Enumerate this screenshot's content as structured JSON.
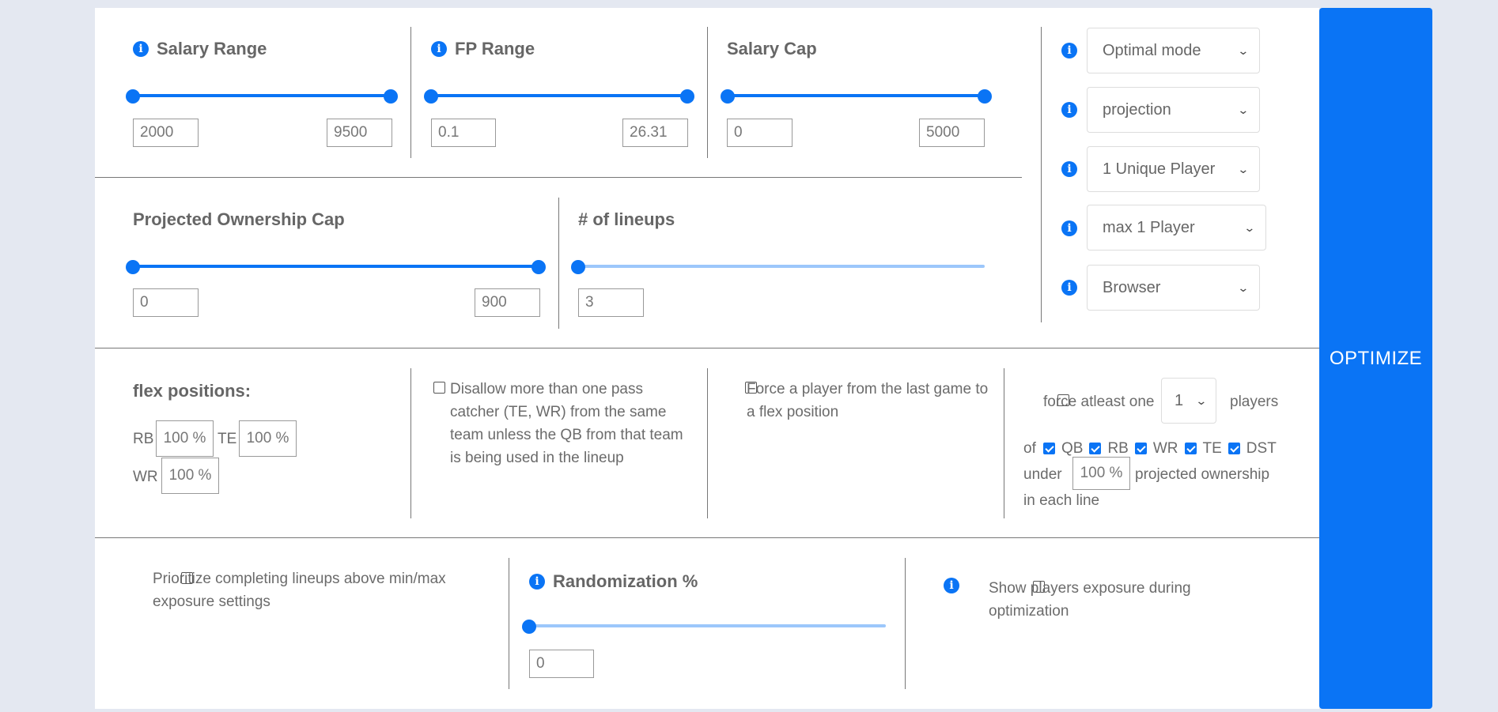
{
  "range_filters": {
    "salary_range": {
      "title": "Salary Range",
      "min": "2000",
      "max": "9500",
      "low_fraction": 0,
      "high_fraction": 1
    },
    "fp_range": {
      "title": "FP Range",
      "min": "0.1",
      "max": "26.31",
      "low_fraction": 0,
      "high_fraction": 1
    },
    "salary_cap": {
      "title": "Salary Cap",
      "min": "0",
      "max": "5000",
      "low_fraction": 0,
      "high_fraction": 1
    },
    "ownership_cap": {
      "title": "Projected Ownership Cap",
      "min": "0",
      "max": "900",
      "low_fraction": 0,
      "high_fraction": 1
    },
    "num_lineups": {
      "title": "# of lineups",
      "value": "3",
      "fraction": 0
    }
  },
  "settings": {
    "mode": "Optimal mode",
    "sort_by": "projection",
    "uniqueness": "1 Unique Player",
    "max_players": "max 1 Player",
    "run_location": "Browser"
  },
  "flex": {
    "title": "flex positions:",
    "rb_label": "RB",
    "rb_value": "100 %",
    "te_label": "TE",
    "te_value": "100 %",
    "wr_label": "WR",
    "wr_value": "100 %"
  },
  "options": {
    "disallow_text": "Disallow more than one pass catcher (TE, WR) from the same team unless the QB from that team is being used in the lineup",
    "disallow_checked": false,
    "force_last_game_text": "Force a player from the last game to a flex position",
    "force_last_game_checked": false,
    "force_atleast_label": "force atleast one",
    "force_atleast_checked": false,
    "force_count": "1",
    "players_label": "players",
    "of_label": "of",
    "positions": [
      {
        "label": "QB",
        "checked": true
      },
      {
        "label": "RB",
        "checked": true
      },
      {
        "label": "WR",
        "checked": true
      },
      {
        "label": "TE",
        "checked": true
      },
      {
        "label": "DST",
        "checked": true
      }
    ],
    "under_label": "under",
    "under_value": "100 %",
    "projected_ownership_label": "projected ownership",
    "in_each_line_label": "in each line"
  },
  "bottom": {
    "prioritize_text": "Prioritize completing lineups above min/max exposure settings",
    "prioritize_checked": false,
    "randomization_title": "Randomization %",
    "randomization_value": "0",
    "randomization_fraction": 0,
    "show_exposure_text": "Show players exposure during optimization",
    "show_exposure_checked": false
  },
  "optimize_label": "OPTIMIZE",
  "colors": {
    "accent": "#0a74f5",
    "track_light": "#9cc7fb",
    "background": "#e4e8f1"
  }
}
